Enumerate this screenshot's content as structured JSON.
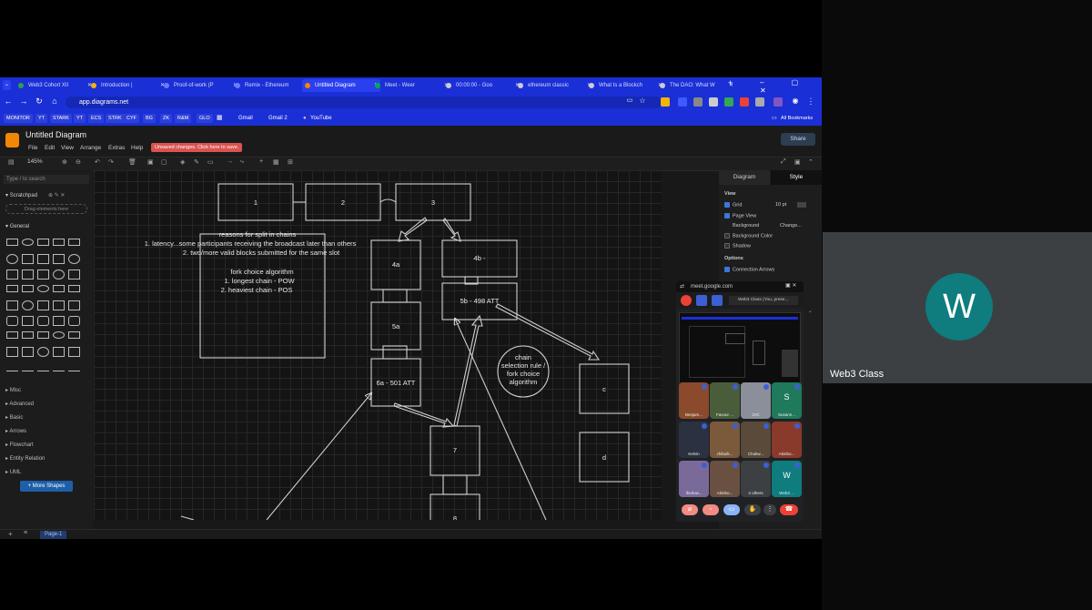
{
  "browser": {
    "tabs": [
      {
        "label": "Web3 Cohort XII",
        "color": "#2ba14b"
      },
      {
        "label": "Introduction |",
        "color": "#f4b400"
      },
      {
        "label": "Proof-of-work (P",
        "color": "#6a7cff"
      },
      {
        "label": "Remix - Ethereum",
        "color": "#6a7cff"
      },
      {
        "label": "Untitled Diagram",
        "color": "#f08705"
      },
      {
        "label": "Meet - Weer",
        "color": "#00ac47"
      },
      {
        "label": "00:00:00 - Goo",
        "color": "#cccccc"
      },
      {
        "label": "ethereum classic",
        "color": "#cccccc"
      },
      {
        "label": "What Is a Blockch",
        "color": "#cccccc"
      },
      {
        "label": "The DAO: What W",
        "color": "#cccccc"
      }
    ],
    "new_tab": "+",
    "url": "app.diagrams.net",
    "bookmarks": [
      "MONITOR",
      "YT",
      "STARK",
      "YT",
      "ECS",
      "STRK",
      "CYF",
      "BG",
      "ZK",
      "R&M",
      "GLO"
    ],
    "bookmark_links": [
      "Gmail",
      "Gmail 2",
      "YouTube"
    ],
    "all_bookmarks": "All Bookmarks"
  },
  "drawio": {
    "doc_title": "Untitled Diagram",
    "menus": [
      "File",
      "Edit",
      "View",
      "Arrange",
      "Extras",
      "Help"
    ],
    "unsaved": "Unsaved changes. Click here to save.",
    "share": "Share",
    "zoom": "145%",
    "search_placeholder": "Type / to search",
    "scratchpad": "Scratchpad",
    "drag_here": "Drag elements here",
    "general": "General",
    "categories": [
      "Misc",
      "Advanced",
      "Basic",
      "Arrows",
      "Flowchart",
      "Entity Relation",
      "UML"
    ],
    "more_shapes": "+ More Shapes",
    "page_tab": "Page-1",
    "right_tabs": [
      "Diagram",
      "Style"
    ],
    "view_heading": "View",
    "grid": "Grid",
    "grid_size": "10 pt",
    "page_view": "Page View",
    "background": "Background",
    "change": "Change...",
    "background_color": "Background Color",
    "shadow": "Shadow",
    "options_heading": "Options",
    "connection_arrows": "Connection Arrows"
  },
  "diagram": {
    "blocks": [
      "1",
      "2",
      "3",
      "4a",
      "4b -",
      "5a",
      "5b - 498 ATT",
      "6a - 501 ATT",
      "7",
      "8",
      "c",
      "d"
    ],
    "reasons_title": "reasons for split in chains",
    "reasons_1": "1. latency...some participants receiving the broadcast later than others",
    "reasons_2": "2. two/more valid blocks submitted for the same slot",
    "fork_title": "fork choice algorithm",
    "fork_1": "1. longest chain - POW",
    "fork_2": "2. heaviest chain - POS",
    "circle_1": "chain",
    "circle_2": "selection rule /",
    "circle_3": "fork choice",
    "circle_4": "algorithm"
  },
  "meet": {
    "pip_url": "meet.google.com",
    "pip_tab": "Web3 Class (You, prese...",
    "participants": [
      {
        "name": "Benjam...",
        "initial": "",
        "color": "#8b4a2b"
      },
      {
        "name": "Favour ...",
        "initial": "",
        "color": "#4a5d3a"
      },
      {
        "name": "JVC",
        "initial": "",
        "color": "#8a8f99"
      },
      {
        "name": "Susann...",
        "initial": "S",
        "color": "#1f7a5c"
      },
      {
        "name": "Kelvin",
        "initial": "",
        "color": "#2b3140"
      },
      {
        "name": "chibuik...",
        "initial": "",
        "color": "#7a5a3a"
      },
      {
        "name": "Chukw...",
        "initial": "",
        "color": "#5a4a3a"
      },
      {
        "name": "Akinbo...",
        "initial": "",
        "color": "#8a3a2a"
      },
      {
        "name": "Ifeoluw...",
        "initial": "",
        "color": "#7a6a9a"
      },
      {
        "name": "Akinbo...",
        "initial": "",
        "color": "#6a5040"
      },
      {
        "name": "4 others",
        "initial": "",
        "color": "#3c4043"
      },
      {
        "name": "Web3 ...",
        "initial": "W",
        "color": "#0f7c7e"
      }
    ],
    "main_participant": {
      "initial": "W",
      "name": "Web3 Class"
    }
  }
}
